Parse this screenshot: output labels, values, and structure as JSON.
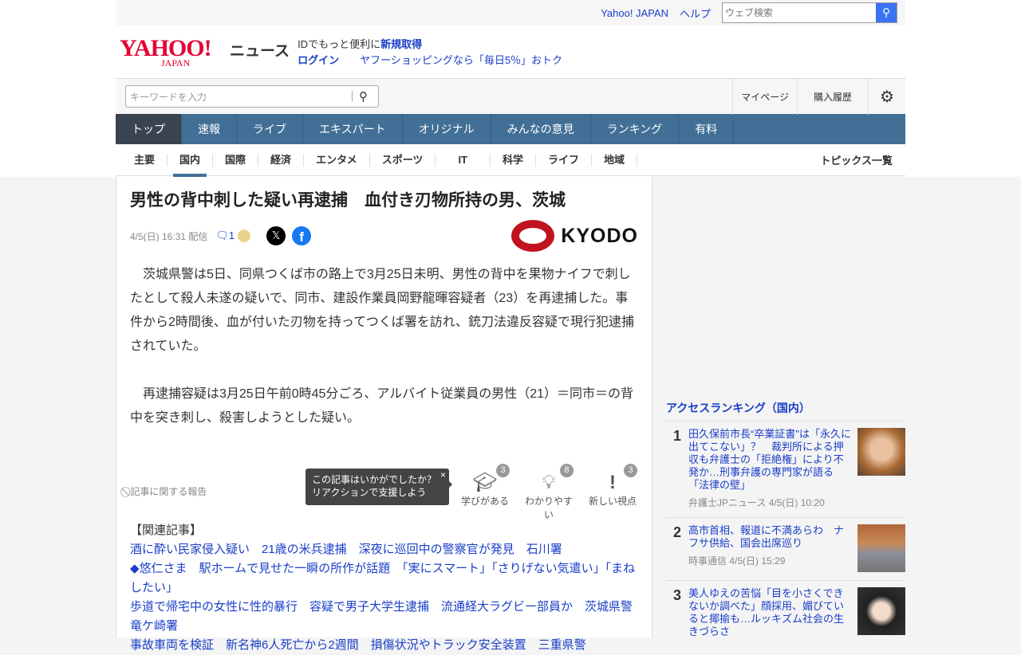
{
  "topbar": {
    "links": [
      "Yahoo! JAPAN",
      "ヘルプ"
    ],
    "search_placeholder": "ウェブ検索"
  },
  "logo": {
    "yahoo": "YAHOO!",
    "japan": "JAPAN",
    "news": "ニュース"
  },
  "promo": {
    "line1": "IDでもっと便利に",
    "signup": "新規取得",
    "login": "ログイン",
    "shopping": "ヤフーショッピングなら「毎日5％」おトク"
  },
  "search": {
    "placeholder": "キーワードを入力"
  },
  "header_links": [
    "マイページ",
    "購入履歴"
  ],
  "nav": [
    "トップ",
    "速報",
    "ライブ",
    "エキスパート",
    "オリジナル",
    "みんなの意見",
    "ランキング",
    "有料"
  ],
  "subnav": [
    "主要",
    "国内",
    "国際",
    "経済",
    "エンタメ",
    "スポーツ",
    "IT",
    "科学",
    "ライフ",
    "地域"
  ],
  "topics_link": "トピックス一覧",
  "article": {
    "title": "男性の背中刺した疑い再逮捕　血付き刃物所持の男、茨城",
    "date": "4/5(日) 16:31 配信",
    "comments": "1",
    "publisher": "KYODO",
    "paragraphs": [
      "　茨城県警は5日、同県つくば市の路上で3月25日未明、男性の背中を果物ナイフで刺したとして殺人未遂の疑いで、同市、建設作業員岡野龍暉容疑者（23）を再逮捕した。事件から2時間後、血が付いた刃物を持ってつくば署を訪れ、銃刀法違反容疑で現行犯逮捕されていた。",
      "　再逮捕容疑は3月25日午前0時45分ごろ、アルバイト従業員の男性（21）＝同市＝の背中を突き刺し、殺害しようとした疑い。"
    ],
    "report": "記事に関する報告",
    "tooltip": {
      "line1": "この記事はいかがでしたか？",
      "line2": "リアクションで支援しよう",
      "close": "×"
    },
    "reactions": [
      {
        "label": "学びがある",
        "count": "3"
      },
      {
        "label": "わかりやすい",
        "count": "8"
      },
      {
        "label": "新しい視点",
        "count": "3"
      }
    ],
    "related_heading": "【関連記事】",
    "related": [
      "酒に酔い民家侵入疑い　21歳の米兵逮捕　深夜に巡回中の警察官が発見　石川署",
      "◆悠仁さま　駅ホームで見せた一瞬の所作が話題　「実にスマート」「さりげない気遣い」「まねしたい」",
      "歩道で帰宅中の女性に性的暴行　容疑で男子大学生逮捕　流通経大ラグビー部員か　茨城県警竜ケ崎署",
      "事故車両を検証　新名神6人死亡から2週間　損傷状況やトラック安全装置　三重県警"
    ]
  },
  "ranking": {
    "title": "アクセスランキング（国内）",
    "items": [
      {
        "rank": "1",
        "title": "田久保前市長“卒業証書\"は「永久に出てこない」？　裁判所による押収も弁護士の「拒絶権」により不発か…刑事弁護の専門家が語る「法律の壁」",
        "source": "弁護士JPニュース 4/5(日) 10:20"
      },
      {
        "rank": "2",
        "title": "高市首相、報道に不満あらわ　ナフサ供給、国会出席巡り",
        "source": "時事通信 4/5(日) 15:29"
      },
      {
        "rank": "3",
        "title": "美人ゆえの苦悩「目を小さくできないか調べた」顔採用、媚びていると揶揄も…ルッキズム社会の生きづらさ",
        "source": ""
      }
    ]
  }
}
